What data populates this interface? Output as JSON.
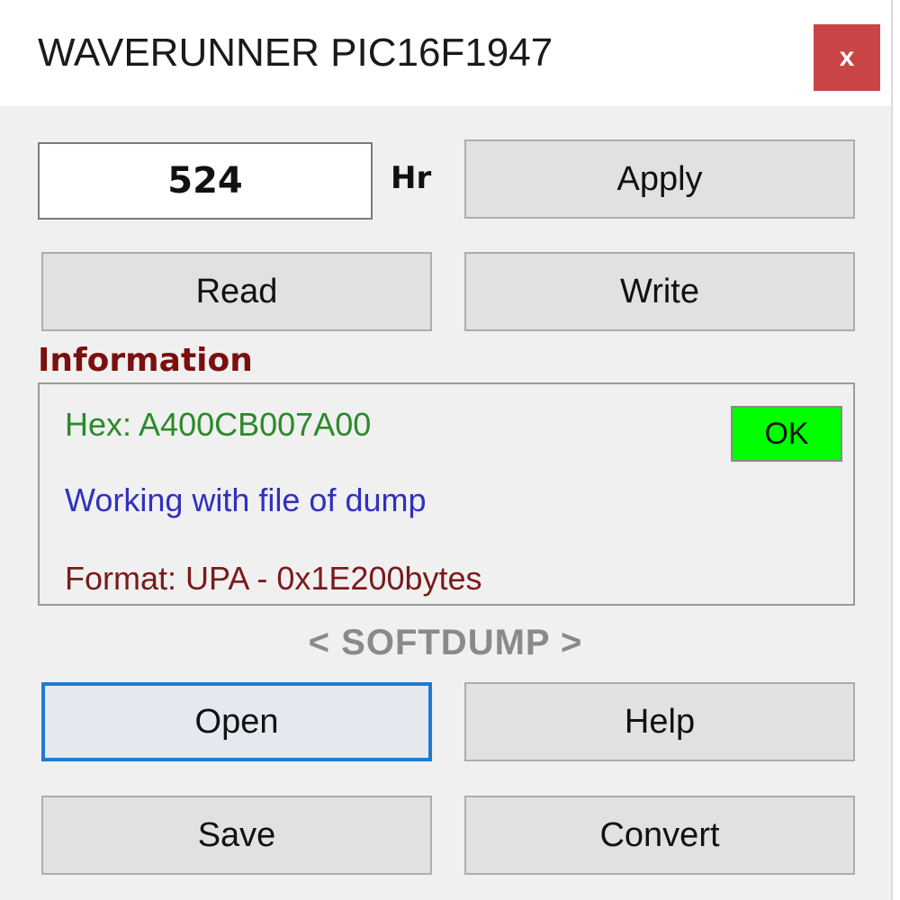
{
  "window": {
    "title": "WAVERUNNER PIC16F1947",
    "close_label": "x"
  },
  "hours": {
    "value": "524",
    "unit": "Hr"
  },
  "buttons": {
    "apply": "Apply",
    "read": "Read",
    "write": "Write",
    "open": "Open",
    "help": "Help",
    "save": "Save",
    "convert": "Convert"
  },
  "information": {
    "label": "Information",
    "hex": "Hex: A400CB007A00",
    "status": "OK",
    "mode": "Working with file of dump",
    "format": "Format: UPA - 0x1E200bytes"
  },
  "branding": {
    "softdump": "< SOFTDUMP >"
  },
  "colors": {
    "close_button": "#c94545",
    "status_ok": "#00ff00",
    "hex_text": "#2a8a2a",
    "mode_text": "#3030c0",
    "format_text": "#7a1a1a",
    "section_label": "#7b0f0f",
    "focus_border": "#1f7ad1"
  }
}
